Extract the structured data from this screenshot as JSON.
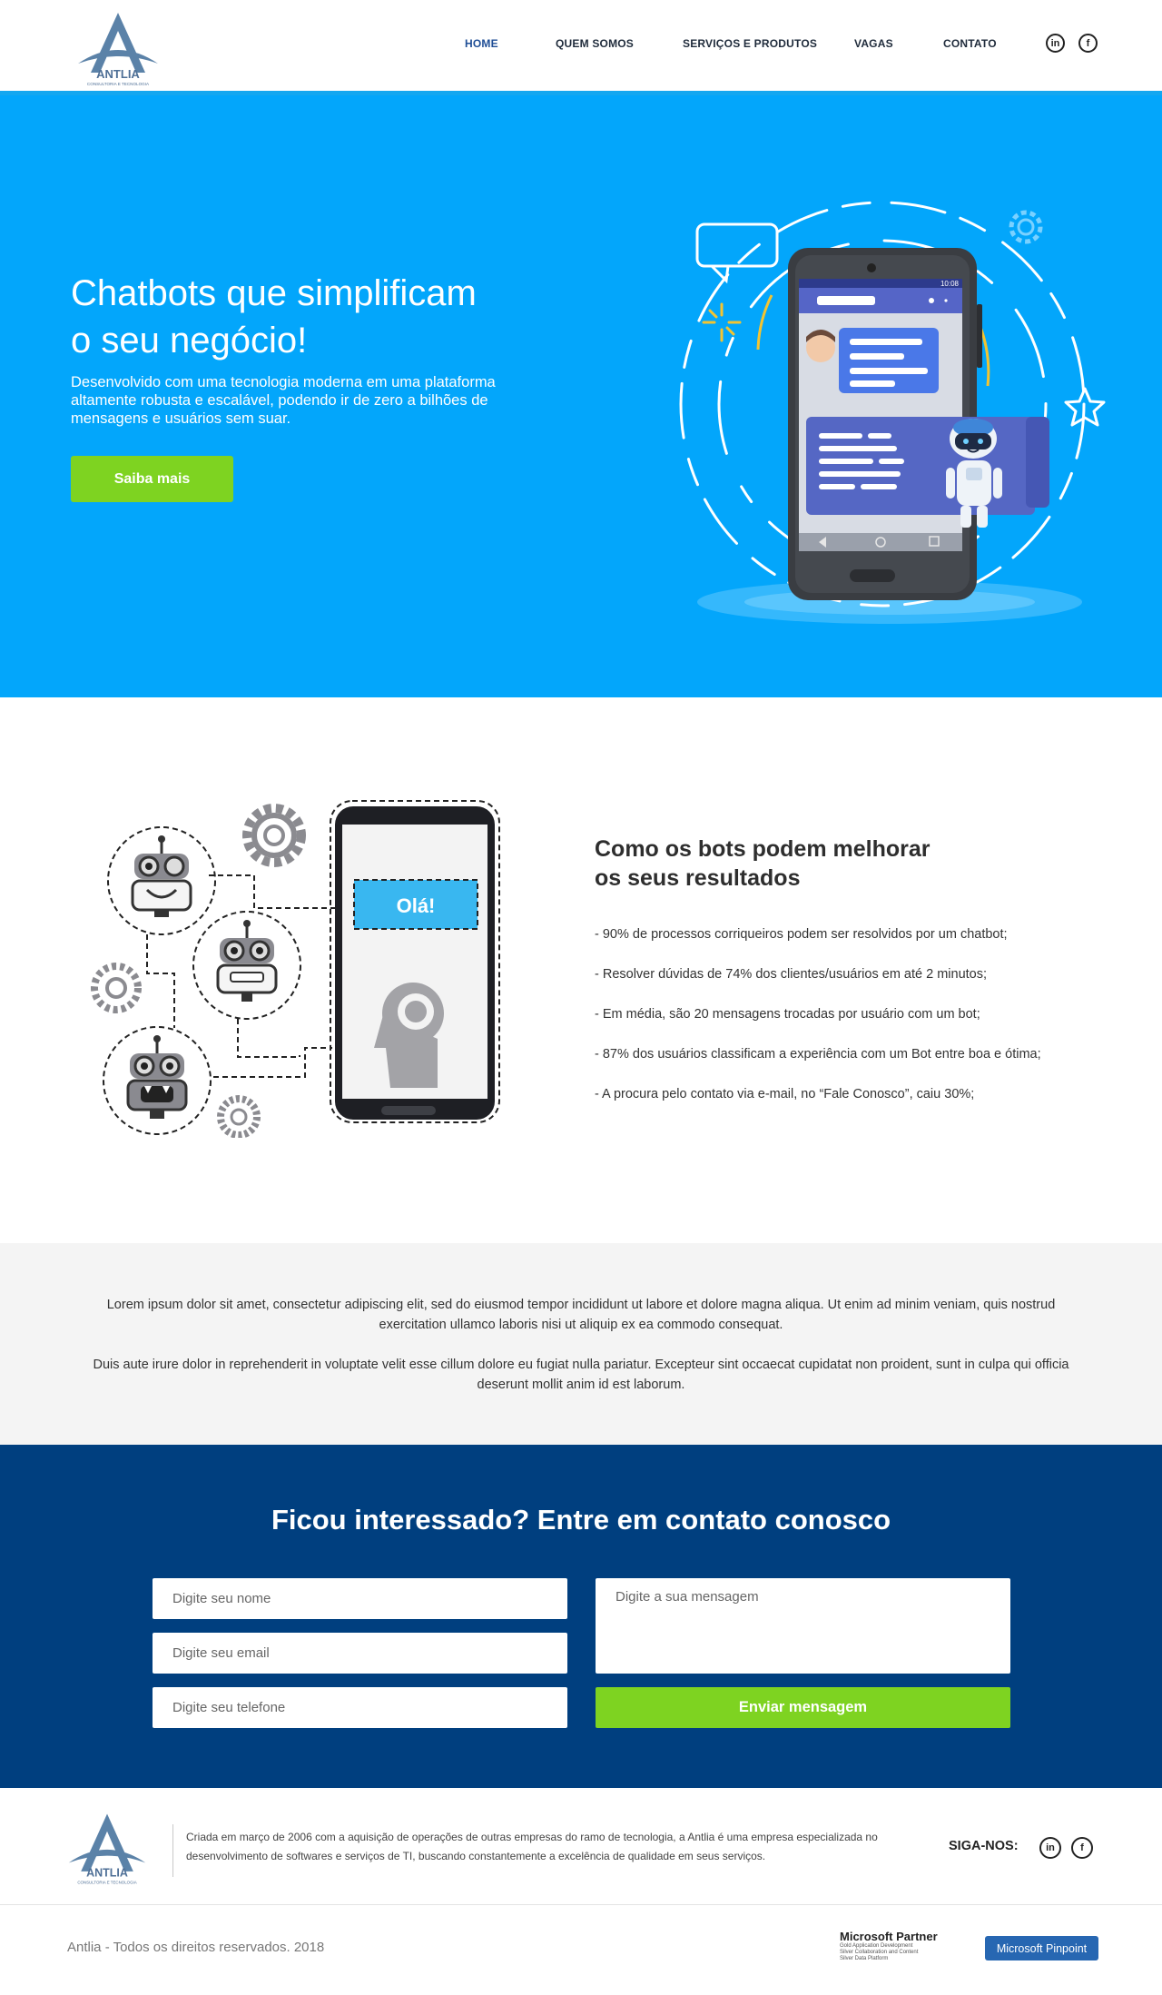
{
  "header": {
    "logo_text": "ANTLIA",
    "logo_tagline": "CONSULTORIA E TECNOLOGIA",
    "nav": [
      {
        "label": "HOME",
        "active": true
      },
      {
        "label": "QUEM SOMOS",
        "active": false
      },
      {
        "label": "SERVIÇOS E PRODUTOS",
        "active": false
      },
      {
        "label": "VAGAS",
        "active": false
      },
      {
        "label": "CONTATO",
        "active": false
      }
    ],
    "social": {
      "linkedin": "in",
      "facebook": "f"
    }
  },
  "hero": {
    "title_line1": "Chatbots que simplificam",
    "title_line2": "o seu negócio!",
    "description": "Desenvolvido com uma tecnologia moderna em uma plataforma altamente robusta e escalável, podendo ir de zero a bilhões de mensagens e usuários sem suar.",
    "button": "Saiba mais",
    "phone_time": "10:08"
  },
  "bots": {
    "bubble": "Olá!",
    "title_line1": "Como os bots podem melhorar",
    "title_line2": "os seus resultados",
    "items": [
      "- 90% de processos corriqueiros podem ser resolvidos por um chatbot;",
      "- Resolver dúvidas de 74% dos clientes/usuários em até 2 minutos;",
      "- Em média, são 20 mensagens trocadas por usuário com um bot;",
      "- 87% dos usuários classificam a experiência com um Bot entre boa e ótima;",
      "- A procura pelo contato via e-mail, no “Fale Conosco”, caiu 30%;"
    ]
  },
  "lorem": {
    "p1": "Lorem ipsum dolor sit amet, consectetur adipiscing elit, sed do eiusmod tempor incididunt ut labore et dolore magna aliqua. Ut enim ad minim veniam, quis nostrud exercitation ullamco laboris nisi ut aliquip ex ea commodo consequat.",
    "p2": "Duis aute irure dolor in reprehenderit in voluptate velit esse cillum dolore eu fugiat nulla pariatur. Excepteur sint occaecat cupidatat non proident, sunt in culpa qui officia deserunt mollit anim id est laborum."
  },
  "contact": {
    "title": "Ficou interessado? Entre em contato conosco",
    "name_placeholder": "Digite seu nome",
    "email_placeholder": "Digite seu email",
    "phone_placeholder": "Digite seu telefone",
    "message_placeholder": "Digite a sua mensagem",
    "submit": "Enviar mensagem"
  },
  "footer": {
    "about": "Criada em março de 2006 com a aquisição de operações de outras empresas do ramo de tecnologia, a Antlia é uma empresa especializada no desenvolvimento de softwares e serviços de TI, buscando constantemente a excelência de qualidade em seus serviços.",
    "follow": "SIGA-NOS:",
    "copyright": "Antlia - Todos os direitos reservados. 2018",
    "ms_partner_title": "Microsoft Partner",
    "ms_partner_lines": [
      "Gold   Application Development",
      "Silver  Collaboration and Content",
      "Silver  Data Platform"
    ],
    "ms_pinpoint": "Microsoft Pinpoint"
  },
  "colors": {
    "hero_bg": "#03a6fb",
    "accent_green": "#7ed321",
    "contact_bg": "#003f7f",
    "nav_active": "#1f4e96"
  }
}
